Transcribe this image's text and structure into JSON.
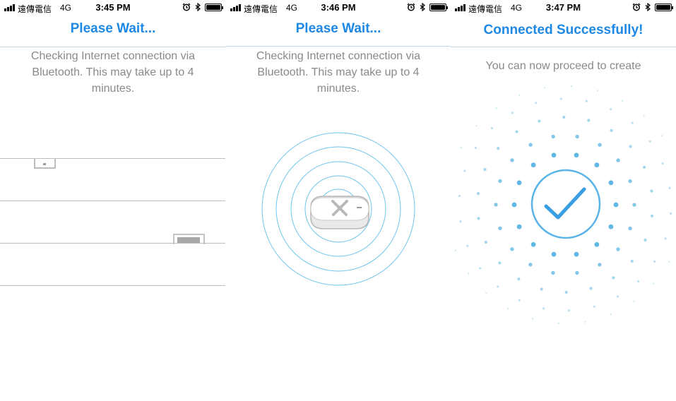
{
  "status_bar": [
    {
      "carrier": "遠傳電信",
      "network": "4G",
      "time": "3:45 PM"
    },
    {
      "carrier": "遠傳電信",
      "network": "4G",
      "time": "3:46 PM"
    },
    {
      "carrier": "遠傳電信",
      "network": "4G",
      "time": "3:47 PM"
    }
  ],
  "screens": [
    {
      "title": "Please Wait...",
      "message": "Checking Internet connection via Bluetooth. This may take up to 4 minutes."
    },
    {
      "title": "Please Wait...",
      "message": "Checking Internet connection via Bluetooth. This may take up to 4 minutes."
    },
    {
      "title": "Connected Successfully!",
      "message": "You can now proceed to create"
    }
  ],
  "colors": {
    "accent": "#1e88e5",
    "ring": "#6fc6ee",
    "dots": "#5ab4e4",
    "check": "#3a9ee2"
  },
  "icons": [
    "signal-icon",
    "alarm-icon",
    "bluetooth-icon",
    "battery-icon",
    "router-icon",
    "checkmark-icon"
  ]
}
